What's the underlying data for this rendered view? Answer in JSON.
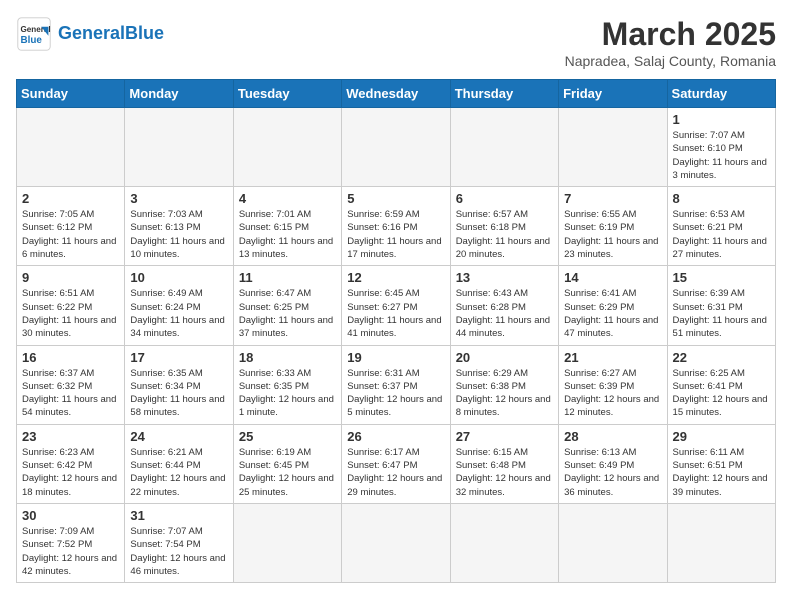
{
  "header": {
    "logo_general": "General",
    "logo_blue": "Blue",
    "month_title": "March 2025",
    "subtitle": "Napradea, Salaj County, Romania"
  },
  "weekdays": [
    "Sunday",
    "Monday",
    "Tuesday",
    "Wednesday",
    "Thursday",
    "Friday",
    "Saturday"
  ],
  "weeks": [
    [
      {
        "day": "",
        "info": ""
      },
      {
        "day": "",
        "info": ""
      },
      {
        "day": "",
        "info": ""
      },
      {
        "day": "",
        "info": ""
      },
      {
        "day": "",
        "info": ""
      },
      {
        "day": "",
        "info": ""
      },
      {
        "day": "1",
        "info": "Sunrise: 7:07 AM\nSunset: 6:10 PM\nDaylight: 11 hours and 3 minutes."
      }
    ],
    [
      {
        "day": "2",
        "info": "Sunrise: 7:05 AM\nSunset: 6:12 PM\nDaylight: 11 hours and 6 minutes."
      },
      {
        "day": "3",
        "info": "Sunrise: 7:03 AM\nSunset: 6:13 PM\nDaylight: 11 hours and 10 minutes."
      },
      {
        "day": "4",
        "info": "Sunrise: 7:01 AM\nSunset: 6:15 PM\nDaylight: 11 hours and 13 minutes."
      },
      {
        "day": "5",
        "info": "Sunrise: 6:59 AM\nSunset: 6:16 PM\nDaylight: 11 hours and 17 minutes."
      },
      {
        "day": "6",
        "info": "Sunrise: 6:57 AM\nSunset: 6:18 PM\nDaylight: 11 hours and 20 minutes."
      },
      {
        "day": "7",
        "info": "Sunrise: 6:55 AM\nSunset: 6:19 PM\nDaylight: 11 hours and 23 minutes."
      },
      {
        "day": "8",
        "info": "Sunrise: 6:53 AM\nSunset: 6:21 PM\nDaylight: 11 hours and 27 minutes."
      }
    ],
    [
      {
        "day": "9",
        "info": "Sunrise: 6:51 AM\nSunset: 6:22 PM\nDaylight: 11 hours and 30 minutes."
      },
      {
        "day": "10",
        "info": "Sunrise: 6:49 AM\nSunset: 6:24 PM\nDaylight: 11 hours and 34 minutes."
      },
      {
        "day": "11",
        "info": "Sunrise: 6:47 AM\nSunset: 6:25 PM\nDaylight: 11 hours and 37 minutes."
      },
      {
        "day": "12",
        "info": "Sunrise: 6:45 AM\nSunset: 6:27 PM\nDaylight: 11 hours and 41 minutes."
      },
      {
        "day": "13",
        "info": "Sunrise: 6:43 AM\nSunset: 6:28 PM\nDaylight: 11 hours and 44 minutes."
      },
      {
        "day": "14",
        "info": "Sunrise: 6:41 AM\nSunset: 6:29 PM\nDaylight: 11 hours and 47 minutes."
      },
      {
        "day": "15",
        "info": "Sunrise: 6:39 AM\nSunset: 6:31 PM\nDaylight: 11 hours and 51 minutes."
      }
    ],
    [
      {
        "day": "16",
        "info": "Sunrise: 6:37 AM\nSunset: 6:32 PM\nDaylight: 11 hours and 54 minutes."
      },
      {
        "day": "17",
        "info": "Sunrise: 6:35 AM\nSunset: 6:34 PM\nDaylight: 11 hours and 58 minutes."
      },
      {
        "day": "18",
        "info": "Sunrise: 6:33 AM\nSunset: 6:35 PM\nDaylight: 12 hours and 1 minute."
      },
      {
        "day": "19",
        "info": "Sunrise: 6:31 AM\nSunset: 6:37 PM\nDaylight: 12 hours and 5 minutes."
      },
      {
        "day": "20",
        "info": "Sunrise: 6:29 AM\nSunset: 6:38 PM\nDaylight: 12 hours and 8 minutes."
      },
      {
        "day": "21",
        "info": "Sunrise: 6:27 AM\nSunset: 6:39 PM\nDaylight: 12 hours and 12 minutes."
      },
      {
        "day": "22",
        "info": "Sunrise: 6:25 AM\nSunset: 6:41 PM\nDaylight: 12 hours and 15 minutes."
      }
    ],
    [
      {
        "day": "23",
        "info": "Sunrise: 6:23 AM\nSunset: 6:42 PM\nDaylight: 12 hours and 18 minutes."
      },
      {
        "day": "24",
        "info": "Sunrise: 6:21 AM\nSunset: 6:44 PM\nDaylight: 12 hours and 22 minutes."
      },
      {
        "day": "25",
        "info": "Sunrise: 6:19 AM\nSunset: 6:45 PM\nDaylight: 12 hours and 25 minutes."
      },
      {
        "day": "26",
        "info": "Sunrise: 6:17 AM\nSunset: 6:47 PM\nDaylight: 12 hours and 29 minutes."
      },
      {
        "day": "27",
        "info": "Sunrise: 6:15 AM\nSunset: 6:48 PM\nDaylight: 12 hours and 32 minutes."
      },
      {
        "day": "28",
        "info": "Sunrise: 6:13 AM\nSunset: 6:49 PM\nDaylight: 12 hours and 36 minutes."
      },
      {
        "day": "29",
        "info": "Sunrise: 6:11 AM\nSunset: 6:51 PM\nDaylight: 12 hours and 39 minutes."
      }
    ],
    [
      {
        "day": "30",
        "info": "Sunrise: 7:09 AM\nSunset: 7:52 PM\nDaylight: 12 hours and 42 minutes."
      },
      {
        "day": "31",
        "info": "Sunrise: 7:07 AM\nSunset: 7:54 PM\nDaylight: 12 hours and 46 minutes."
      },
      {
        "day": "",
        "info": ""
      },
      {
        "day": "",
        "info": ""
      },
      {
        "day": "",
        "info": ""
      },
      {
        "day": "",
        "info": ""
      },
      {
        "day": "",
        "info": ""
      }
    ]
  ]
}
